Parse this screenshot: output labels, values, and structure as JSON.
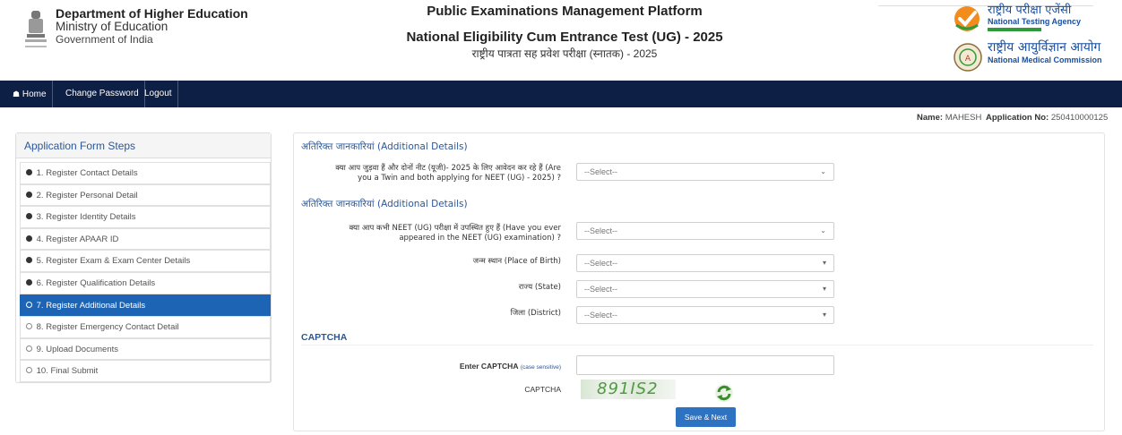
{
  "header": {
    "dept_line1": "Department of Higher Education",
    "dept_line2": "Ministry of Education",
    "dept_line3": "Government of India",
    "title1": "Public Examinations Management Platform",
    "title2": "National Eligibility Cum Entrance Test (UG) - 2025",
    "title3": "राष्ट्रीय पात्रता सह प्रवेश परीक्षा (स्नातक) - 2025",
    "nta_hindi": "राष्ट्रीय परीक्षा एजेंसी",
    "nta_english": "National Testing Agency",
    "nmc_hindi": "राष्ट्रीय आयुर्विज्ञान आयोग",
    "nmc_english": "National Medical Commission"
  },
  "navbar": {
    "home": "Home",
    "change_password": "Change Password",
    "logout": "Logout"
  },
  "user": {
    "name_label": "Name:",
    "name": "MAHESH",
    "app_label": "Application No:",
    "app_no": "250410000125"
  },
  "sidebar": {
    "title": "Application Form Steps",
    "steps": [
      "1. Register Contact Details",
      "2. Register Personal Detail",
      "3. Register Identity Details",
      "4. Register APAAR ID",
      "5. Register Exam & Exam Center Details",
      "6. Register Qualification Details",
      "7. Register Additional Details",
      "8. Register Emergency Contact Detail",
      "9. Upload Documents",
      "10. Final Submit"
    ]
  },
  "form": {
    "section1_title": "अतिरिक्त जानकारियां (Additional Details)",
    "twin_q_line1": "क्या आप जुड़वा हैं और दोनों नीट (यूजी)- 2025 के लिए आवेदन कर रहे हैं (Are",
    "twin_q_line2": "you a Twin and both applying for NEET (UG) - 2025) ?",
    "twin_value": "--Select--",
    "section2_title": "अतिरिक्त जानकारियां (Additional Details)",
    "appeared_q_line1": "क्या आप कभी NEET (UG) परीक्षा में उपस्थित हुए हैं (Have you ever",
    "appeared_q_line2": "appeared in the NEET (UG) examination) ?",
    "appeared_value": "--Select--",
    "birth_label": "जन्म स्थान (Place of Birth)",
    "birth_value": "--Select--",
    "state_label": "राज्य (State)",
    "state_value": "--Select--",
    "district_label": "जिला (District)",
    "district_value": "--Select--",
    "captcha_title": "CAPTCHA",
    "enter_captcha_label": "Enter CAPTCHA",
    "case_sensitive": "(case sensitive)",
    "captcha_label": "CAPTCHA",
    "captcha_text": "891IS2",
    "submit_label": "Save & Next"
  },
  "colors": {
    "navbar": "#0d1f44",
    "accent": "#2b5797",
    "active_step": "#1e64b4",
    "button": "#2e73c2"
  }
}
